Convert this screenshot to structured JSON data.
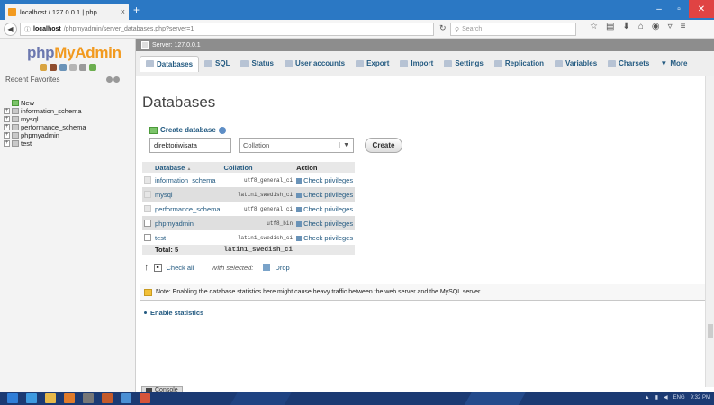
{
  "browser": {
    "tab_title": "localhost / 127.0.0.1 | php...",
    "tab_close": "×",
    "new_tab": "+",
    "url_host": "localhost",
    "url_path": "/phpmyadmin/server_databases.php?server=1",
    "search_placeholder": "Search",
    "window_controls": [
      "–",
      "▫",
      "✕"
    ]
  },
  "pma": {
    "logo_php": "php",
    "logo_mya": "MyAdmin",
    "recent_label": "Recent",
    "favorites_label": "Favorites",
    "tree": [
      {
        "label": "New",
        "type": "new"
      },
      {
        "label": "information_schema",
        "type": "db"
      },
      {
        "label": "mysql",
        "type": "db"
      },
      {
        "label": "performance_schema",
        "type": "db"
      },
      {
        "label": "phpmyadmin",
        "type": "db"
      },
      {
        "label": "test",
        "type": "db"
      }
    ],
    "server_label": "Server: 127.0.0.1",
    "tabs": [
      {
        "label": "Databases",
        "active": true
      },
      {
        "label": "SQL"
      },
      {
        "label": "Status"
      },
      {
        "label": "User accounts"
      },
      {
        "label": "Export"
      },
      {
        "label": "Import"
      },
      {
        "label": "Settings"
      },
      {
        "label": "Replication"
      },
      {
        "label": "Variables"
      },
      {
        "label": "Charsets"
      },
      {
        "label": "More"
      }
    ]
  },
  "main": {
    "page_title": "Databases",
    "create_header": "Create database",
    "db_name_value": "direktoriwisata",
    "collation_value": "Collation",
    "create_button": "Create",
    "table": {
      "headers": {
        "database": "Database",
        "collation": "Collation",
        "action": "Action"
      },
      "sort_marker": "▲",
      "rows": [
        {
          "name": "information_schema",
          "collation": "utf8_general_ci",
          "action": "Check privileges",
          "checkbox_disabled": true
        },
        {
          "name": "mysql",
          "collation": "latin1_swedish_ci",
          "action": "Check privileges",
          "checkbox_disabled": true
        },
        {
          "name": "performance_schema",
          "collation": "utf8_general_ci",
          "action": "Check privileges",
          "checkbox_disabled": true
        },
        {
          "name": "phpmyadmin",
          "collation": "utf8_bin",
          "action": "Check privileges",
          "checkbox_disabled": false
        },
        {
          "name": "test",
          "collation": "latin1_swedish_ci",
          "action": "Check privileges",
          "checkbox_disabled": false
        }
      ],
      "total_label": "Total: 5",
      "total_collation": "latin1_swedish_ci"
    },
    "check_all": "Check all",
    "with_selected": "With selected:",
    "drop": "Drop",
    "notice": "Note: Enabling the database statistics here might cause heavy traffic between the web server and the MySQL server.",
    "enable_statistics": "Enable statistics",
    "console": "Console"
  },
  "taskbar": {
    "tray_lang": "ENG",
    "tray_time": "9:32 PM"
  },
  "colors": {
    "browser_blue": "#2b78c4",
    "link_blue": "#235a81",
    "logo_blue": "#6c78af",
    "logo_orange": "#f29a1f",
    "taskbar": "#1b3a73"
  }
}
